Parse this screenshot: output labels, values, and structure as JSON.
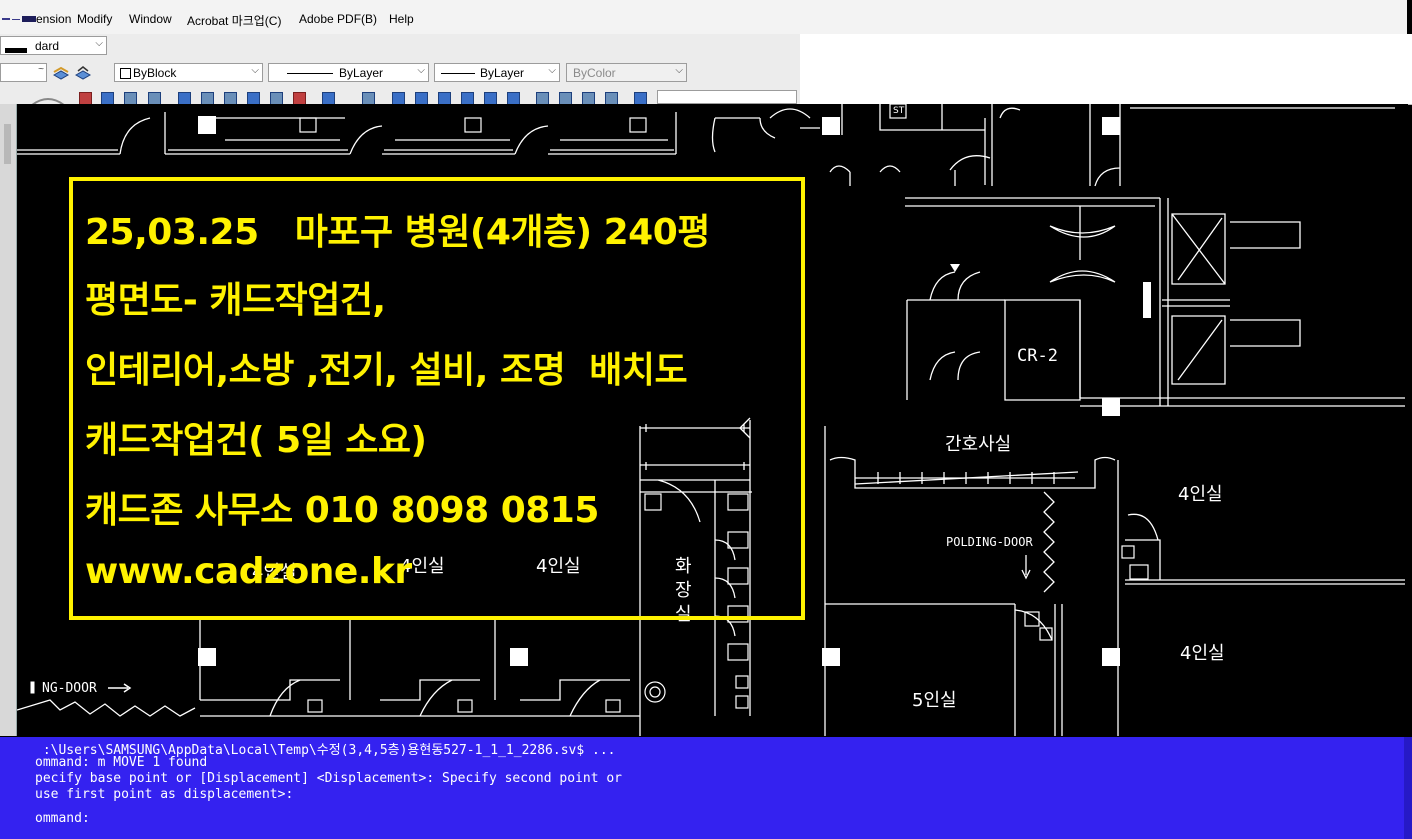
{
  "menu": [
    "ension",
    "Modify",
    "Window",
    "Acrobat 마크업(C)",
    "Adobe PDF(B)",
    "Help"
  ],
  "toolbar": {
    "style_combo": "dard",
    "color_combo": "ByBlock",
    "linetype_combo": "ByLayer",
    "lineweight_combo": "ByLayer",
    "plotstyle_combo": "ByColor"
  },
  "drawing_labels": {
    "room_4_1": "4인실",
    "room_4_2": "4인실",
    "room_4_3": "4인실",
    "room_4_4": "4인실",
    "room_4_5": "4인실",
    "room_5": "5인실",
    "nurse": "간호사실",
    "cr2": "CR-2",
    "toilet_1": "화",
    "toilet_2": "장",
    "toilet_3": "실",
    "folding": "POLDING-DOOR",
    "ngdoor": "NG-DOOR",
    "st": "ST"
  },
  "promo": {
    "line1": "25,03.25   마포구 병원(4개층) 240평",
    "line2": "평면도- 캐드작업건,",
    "line3": "인테리어,소방 ,전기, 설비, 조명  배치도",
    "line4": "캐드작업건( 5일 소요)",
    "line5": "캐드존 사무소 010 8098 0815",
    "line6": "www.cadzone.kr"
  },
  "command": {
    "line1": " :\\Users\\SAMSUNG\\AppData\\Local\\Temp\\수정(3,4,5층)용현동527-1_1_1_2286.sv$ ...",
    "line2": "ommand: m MOVE 1 found",
    "line3": "pecify base point or [Displacement] <Displacement>: Specify second point or",
    "line4": "use first point as displacement>:",
    "line5": "ommand:"
  },
  "colors": {
    "accent": "#fff200",
    "command_bg": "#3422f0",
    "drawing_bg": "#000000",
    "lines": "#ffffff"
  }
}
